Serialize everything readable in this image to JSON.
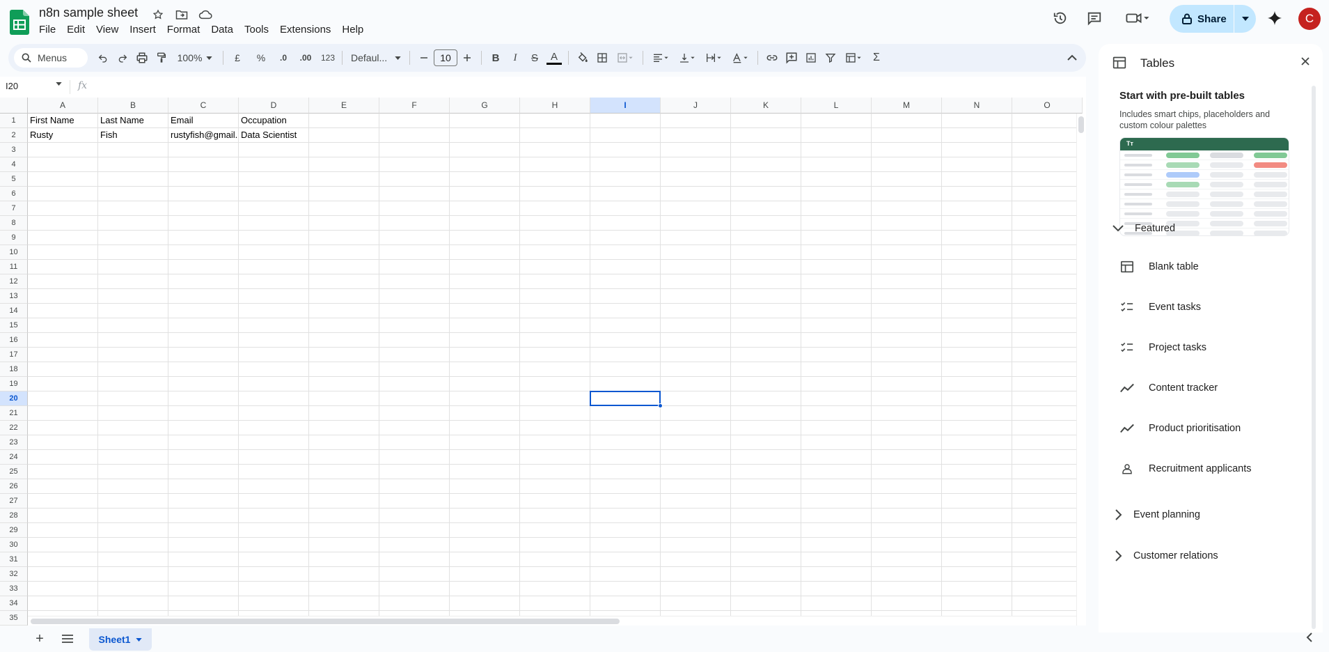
{
  "header": {
    "title": "n8n sample sheet",
    "menu": [
      "File",
      "Edit",
      "View",
      "Insert",
      "Format",
      "Data",
      "Tools",
      "Extensions",
      "Help"
    ],
    "share_label": "Share",
    "avatar_initial": "C"
  },
  "toolbar": {
    "menus_label": "Menus",
    "zoom": "100%",
    "currency": "£",
    "percent": "%",
    "dec_decrease": ".0",
    "dec_increase": ".00",
    "number_format": "123",
    "font": "Defaul...",
    "font_size": "10",
    "bold": "B",
    "italic": "I",
    "strike": "S",
    "text_color": "A",
    "sum": "Σ"
  },
  "formula_bar": {
    "name_box": "I20",
    "fx": "fx"
  },
  "sheet": {
    "columns": [
      "A",
      "B",
      "C",
      "D",
      "E",
      "F",
      "G",
      "H",
      "I",
      "J",
      "K",
      "L",
      "M",
      "N",
      "O"
    ],
    "selected_column": "I",
    "selected_row": "20",
    "rows": [
      "1",
      "2",
      "3",
      "4",
      "5",
      "6",
      "7",
      "8",
      "9",
      "10",
      "11",
      "12",
      "13",
      "14",
      "15",
      "16",
      "17",
      "18",
      "19",
      "20",
      "21",
      "22",
      "23",
      "24",
      "25",
      "26",
      "27",
      "28",
      "29",
      "30",
      "31",
      "32",
      "33",
      "34",
      "35"
    ],
    "data": [
      [
        "First Name",
        "Last Name",
        "Email",
        "Occupation"
      ],
      [
        "Rusty",
        "Fish",
        "rustyfish@gmail.",
        "Data Scientist"
      ]
    ]
  },
  "tabs": {
    "add": "+",
    "active_sheet": "Sheet1"
  },
  "panel": {
    "title": "Tables",
    "prebuilt_title": "Start with pre-built tables",
    "prebuilt_desc": "Includes smart chips, placeholders and custom colour palettes",
    "preview_header": "Tт",
    "featured_label": "Featured",
    "items": [
      {
        "label": "Blank table",
        "icon": "table-icon"
      },
      {
        "label": "Event tasks",
        "icon": "checklist-icon"
      },
      {
        "label": "Project tasks",
        "icon": "checklist-icon"
      },
      {
        "label": "Content tracker",
        "icon": "trend-icon"
      },
      {
        "label": "Product prioritisation",
        "icon": "trend-icon"
      },
      {
        "label": "Recruitment applicants",
        "icon": "person-icon"
      }
    ],
    "sections": [
      "Event planning",
      "Customer relations"
    ]
  },
  "colors": {
    "accent": "#0b57d0",
    "share_bg": "#c2e7ff",
    "avatar_bg": "#c5221f",
    "sheets_green": "#0f9d58"
  }
}
